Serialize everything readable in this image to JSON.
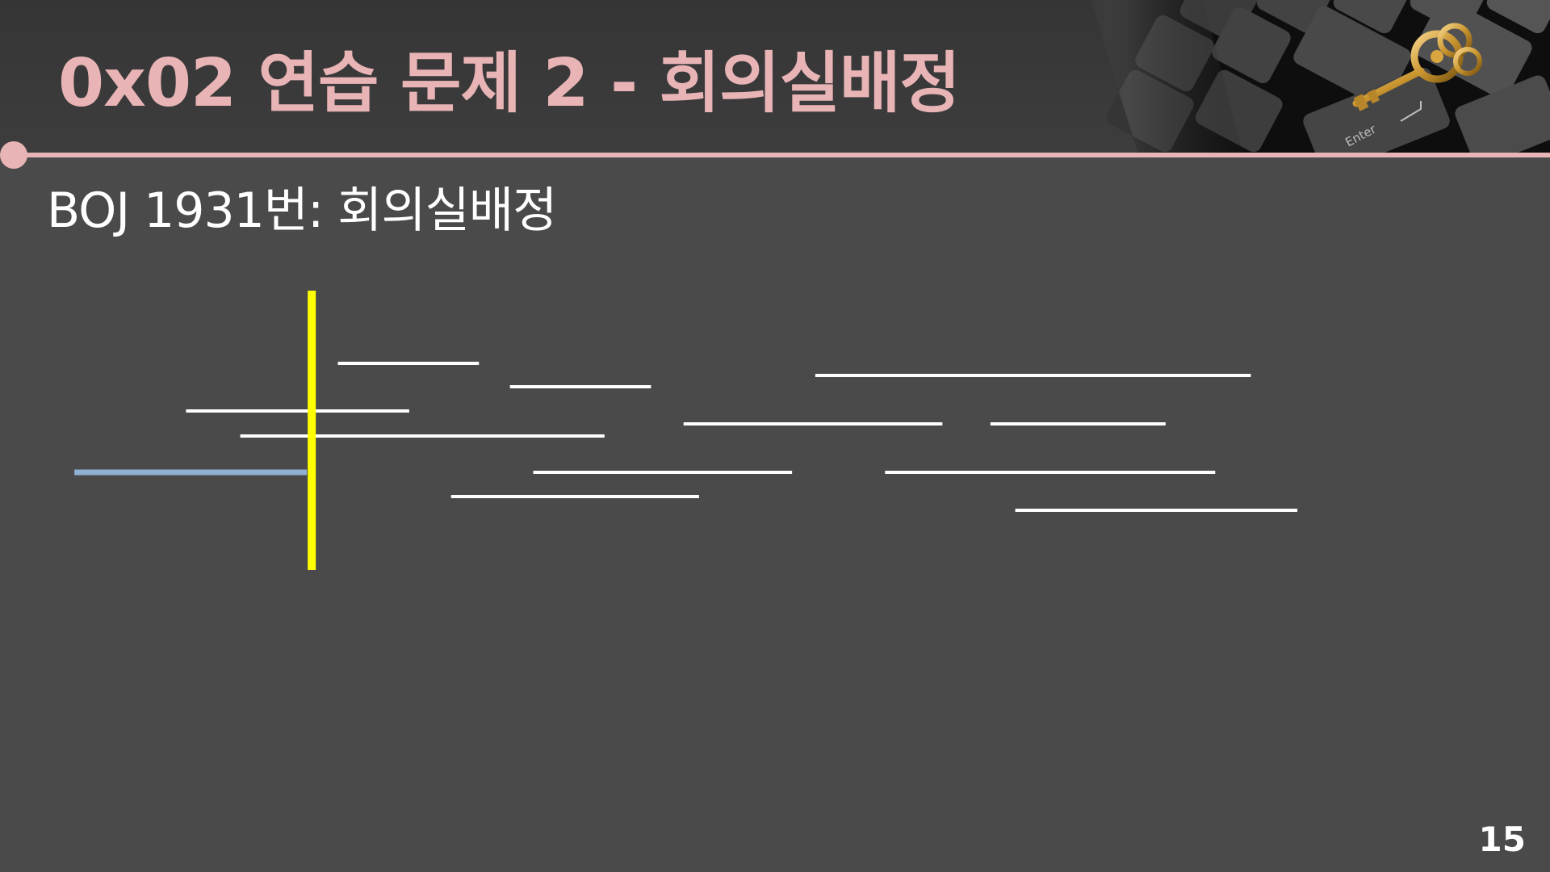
{
  "header": {
    "title": "0x02  연습 문제 2 - 회의실배정"
  },
  "content": {
    "subtitle": "BOJ 1931번: 회의실배정"
  },
  "footer": {
    "page_number": "15"
  },
  "colors": {
    "accent": "#e8b4b5",
    "background": "#4b4a4b",
    "header_background": "#3a393a",
    "interval": "#ffffff",
    "selected_interval": "#8fb0d0",
    "scan_line": "#ffff00"
  },
  "decoration": {
    "header_photo": "keyboard-with-golden-key",
    "key_label": "Enter"
  },
  "diagram": {
    "scan_position": 0.198,
    "intervals": [
      {
        "start": 0.218,
        "end": 0.309,
        "selected": false
      },
      {
        "start": 0.329,
        "end": 0.42,
        "selected": false
      },
      {
        "start": 0.526,
        "end": 0.807,
        "selected": false
      },
      {
        "start": 0.12,
        "end": 0.264,
        "selected": false
      },
      {
        "start": 0.155,
        "end": 0.39,
        "selected": false
      },
      {
        "start": 0.441,
        "end": 0.608,
        "selected": false
      },
      {
        "start": 0.639,
        "end": 0.752,
        "selected": false
      },
      {
        "start": 0.048,
        "end": 0.198,
        "selected": true
      },
      {
        "start": 0.344,
        "end": 0.511,
        "selected": false
      },
      {
        "start": 0.571,
        "end": 0.784,
        "selected": false
      },
      {
        "start": 0.291,
        "end": 0.451,
        "selected": false
      },
      {
        "start": 0.655,
        "end": 0.837,
        "selected": false
      }
    ]
  }
}
